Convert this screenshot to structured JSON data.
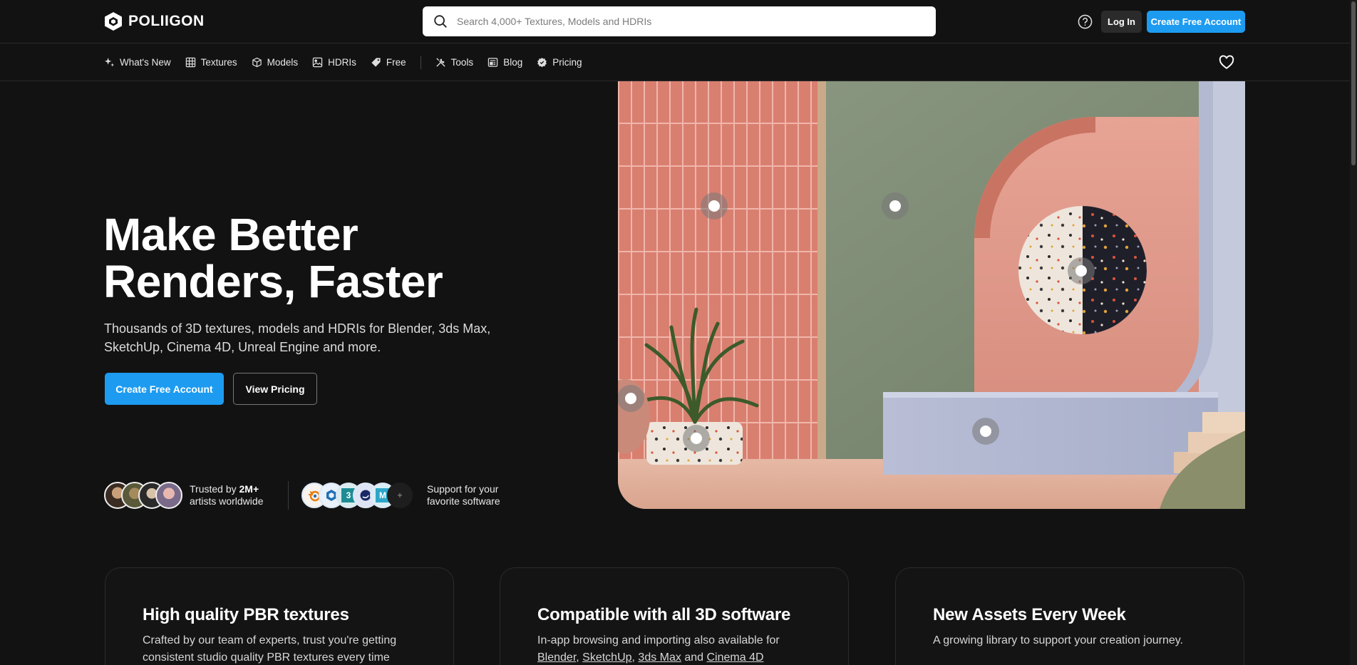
{
  "brand": {
    "name": "POLIIGON"
  },
  "search": {
    "placeholder": "Search 4,000+ Textures, Models and HDRIs"
  },
  "header": {
    "login_label": "Log In",
    "create_label": "Create Free Account"
  },
  "nav": {
    "items": [
      {
        "label": "What's New",
        "icon": "sparkle-icon"
      },
      {
        "label": "Textures",
        "icon": "grid-icon"
      },
      {
        "label": "Models",
        "icon": "cube-icon"
      },
      {
        "label": "HDRIs",
        "icon": "image-icon"
      },
      {
        "label": "Free",
        "icon": "tag-icon"
      },
      {
        "label": "Tools",
        "icon": "tools-icon"
      },
      {
        "label": "Blog",
        "icon": "blog-icon"
      },
      {
        "label": "Pricing",
        "icon": "badge-icon"
      }
    ]
  },
  "hero": {
    "title_line1": "Make Better",
    "title_line2": "Renders, Faster",
    "subtitle": "Thousands of 3D textures, models and HDRIs for Blender, 3ds Max, SketchUp, Cinema 4D, Unreal Engine and more.",
    "cta_primary": "Create Free Account",
    "cta_secondary": "View Pricing"
  },
  "trust": {
    "prefix": "Trusted by",
    "count": "2M+",
    "suffix": "artists worldwide",
    "software_line1": "Support for your",
    "software_line2": "favorite software",
    "software_icons": [
      "blender-icon",
      "sketchup-icon",
      "3dsmax-icon",
      "cinema4d-icon",
      "maya-icon",
      "more-icon"
    ]
  },
  "cards": [
    {
      "title": "High quality PBR textures",
      "text": "Crafted by our team of experts, trust you're getting consistent studio quality PBR textures every time"
    },
    {
      "title": "Compatible with all 3D software",
      "text_prefix": "In-app browsing and importing also available for",
      "links": [
        "Blender",
        "SketchUp",
        "3ds Max",
        "Cinema 4D"
      ],
      "sep1": ", ",
      "sep2": ", ",
      "sep3": " and "
    },
    {
      "title": "New Assets Every Week",
      "text": "A growing library to support your creation journey."
    }
  ],
  "colors": {
    "accent": "#1d9bf0",
    "background": "#121212"
  }
}
